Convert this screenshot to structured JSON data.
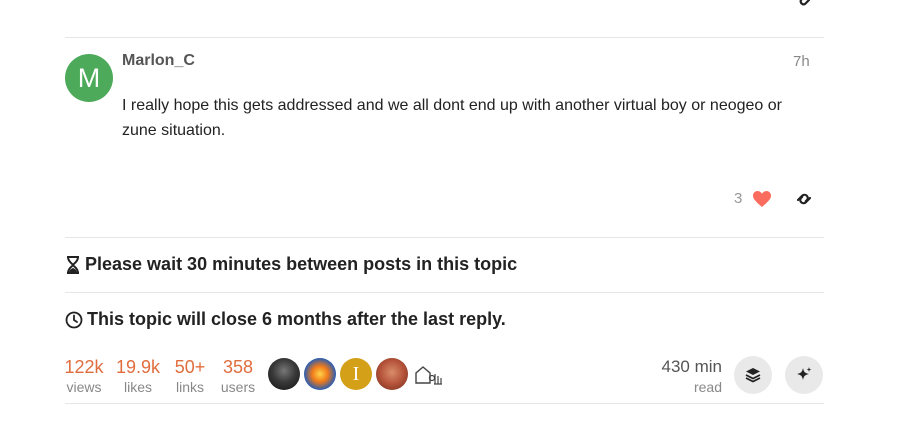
{
  "post": {
    "avatar_letter": "M",
    "username": "Marlon_C",
    "age": "7h",
    "body": "I really hope this gets addressed and we all dont end up with another virtual boy or neogeo or zune situation.",
    "like_count": "3"
  },
  "notices": {
    "slow_mode": "Please wait 30 minutes between posts in this topic",
    "auto_close": "This topic will close 6 months after the last reply."
  },
  "stats": {
    "views": {
      "value": "122k",
      "label": "views"
    },
    "likes": {
      "value": "19.9k",
      "label": "likes"
    },
    "links": {
      "value": "50+",
      "label": "links"
    },
    "users": {
      "value": "358",
      "label": "users"
    }
  },
  "participants": [
    {
      "icon": "avatar-dark-figure"
    },
    {
      "icon": "avatar-fire-swirl"
    },
    {
      "letter": "I",
      "color": "#d4a017"
    },
    {
      "icon": "avatar-red-face"
    }
  ],
  "read_time": {
    "value": "430 min",
    "label": "read"
  },
  "colors": {
    "accent": "#e06d3d",
    "avatar_green": "#4caa5a",
    "heart": "#fa6c5d"
  }
}
